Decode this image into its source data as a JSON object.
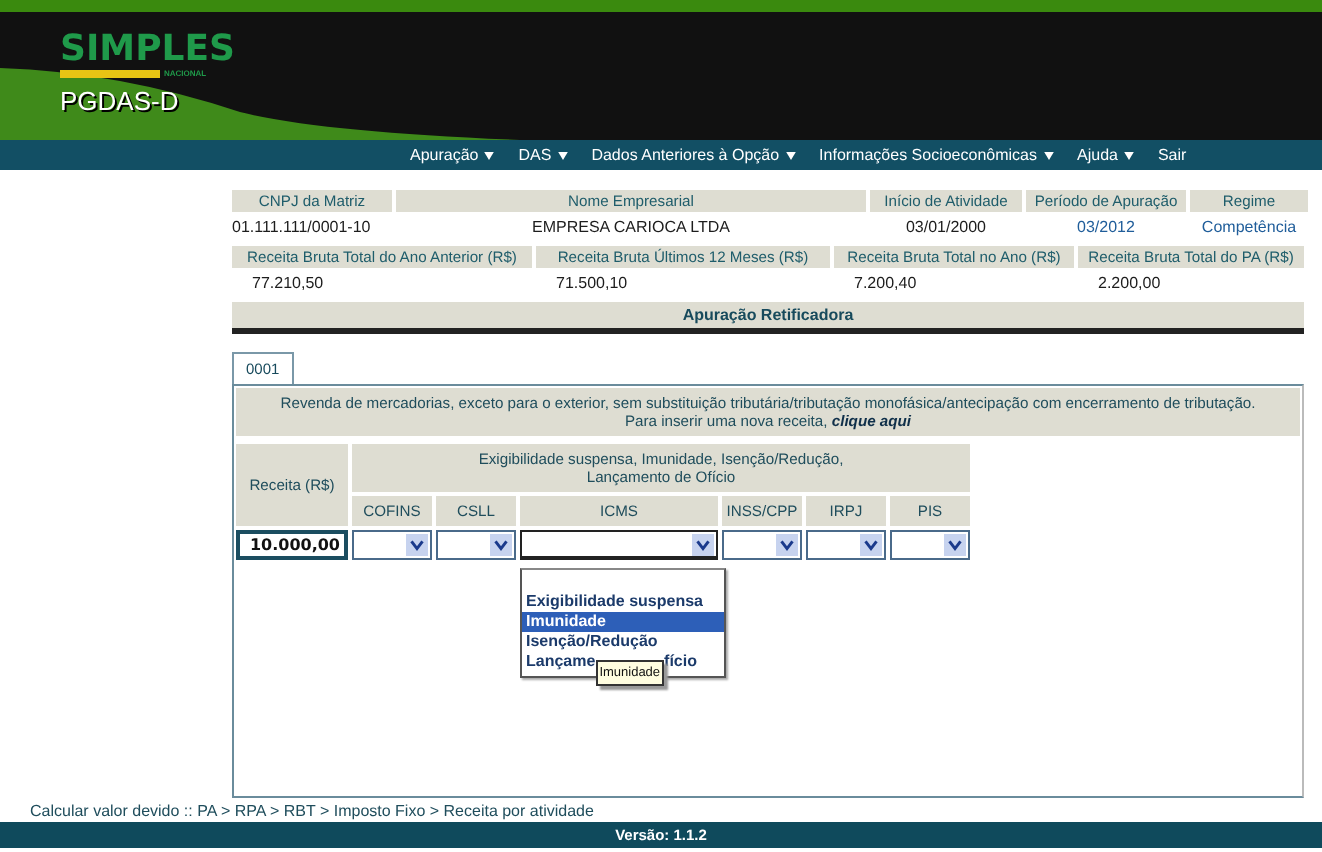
{
  "header": {
    "logo_text": "SIMPLES",
    "logo_subtext": "NACIONAL",
    "app_name": "PGDAS-D"
  },
  "menu": [
    {
      "label": "Apuração",
      "has_caret": true
    },
    {
      "label": "DAS",
      "has_caret": true
    },
    {
      "label": "Dados Anteriores à Opção",
      "has_caret": true
    },
    {
      "label": "Informações Socioeconômicas",
      "has_caret": true
    },
    {
      "label": "Ajuda",
      "has_caret": true
    },
    {
      "label": "Sair",
      "has_caret": false
    }
  ],
  "summary": {
    "row1": [
      {
        "label": "CNPJ da Matriz",
        "value": "01.111.111/0001-10",
        "link": false
      },
      {
        "label": "Nome Empresarial",
        "value": "EMPRESA CARIOCA LTDA",
        "link": false
      },
      {
        "label": "Início de Atividade",
        "value": "03/01/2000",
        "link": false
      },
      {
        "label": "Período de Apuração",
        "value": "03/2012",
        "link": true
      },
      {
        "label": "Regime",
        "value": "Competência",
        "link": true
      }
    ],
    "row2": [
      {
        "label": "Receita Bruta Total do Ano Anterior (R$)",
        "value": "77.210,50"
      },
      {
        "label": "Receita Bruta Últimos 12 Meses (R$)",
        "value": "71.500,10"
      },
      {
        "label": "Receita Bruta Total no Ano (R$)",
        "value": "7.200,40"
      },
      {
        "label": "Receita Bruta Total do PA (R$)",
        "value": "2.200,00"
      }
    ],
    "title": "Apuração Retificadora"
  },
  "tabs": [
    {
      "label": "0001",
      "selected": true
    }
  ],
  "activity": {
    "description": "Revenda de mercadorias, exceto para o exterior, sem substituição tributária/tributação monofásica/antecipação com encerramento de tributação.",
    "insert_text": "Para inserir uma nova receita, ",
    "insert_link": "clique aqui"
  },
  "form": {
    "receita_label": "Receita (R$)",
    "group_label": "Exigibilidade suspensa, Imunidade, Isenção/Redução,",
    "group_label_2": "Lançamento de Ofício",
    "receita_value": "10.000,00",
    "taxes": [
      {
        "label": "COFINS",
        "open": false
      },
      {
        "label": "CSLL",
        "open": false
      },
      {
        "label": "ICMS",
        "open": true
      },
      {
        "label": "INSS/CPP",
        "open": false
      },
      {
        "label": "IRPJ",
        "open": false
      },
      {
        "label": "PIS",
        "open": false
      }
    ]
  },
  "dropdown": {
    "options": [
      {
        "label": "Exigibilidade suspensa",
        "selected": false
      },
      {
        "label": "Imunidade",
        "selected": true
      },
      {
        "label": "Isenção/Redução",
        "selected": false
      },
      {
        "label": "Lançame",
        "label_after": "fício",
        "selected": false
      }
    ],
    "tooltip": "Imunidade"
  },
  "breadcrumb": "Calcular valor devido :: PA > RPA > RBT > Imposto Fixo > Receita por atividade",
  "version": "Versão: 1.1.2"
}
